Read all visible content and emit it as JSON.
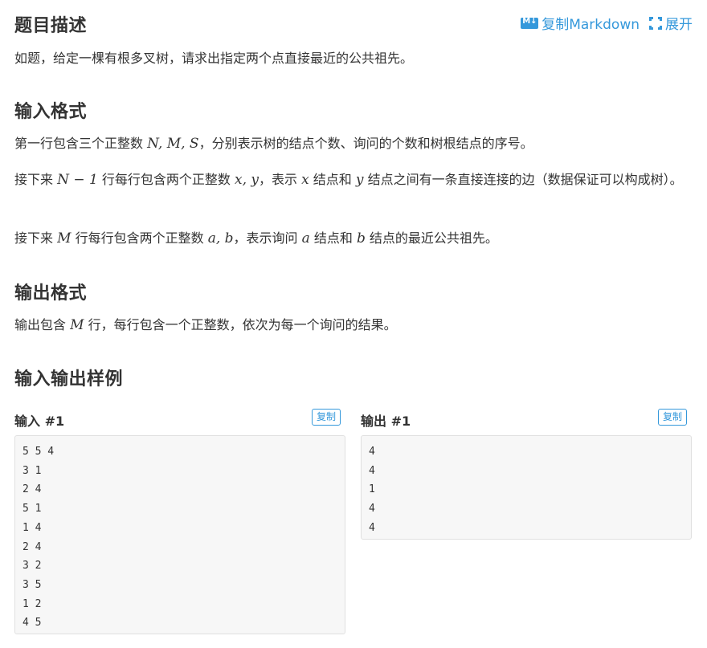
{
  "header": {
    "title": "题目描述",
    "copy_markdown": "复制Markdown",
    "expand": "展开"
  },
  "description": {
    "text": "如题，给定一棵有根多叉树，请求出指定两个点直接最近的公共祖先。"
  },
  "input_format": {
    "title": "输入格式",
    "p1": {
      "a": "第一行包含三个正整数 ",
      "math": "N, M, S",
      "b": "，分别表示树的结点个数、询问的个数和树根结点的序号。"
    },
    "p2": {
      "a": "接下来 ",
      "math1": "N − 1",
      "b": " 行每行包含两个正整数 ",
      "math2": "x, y",
      "c": "，表示 ",
      "math3": "x",
      "d": " 结点和 ",
      "math4": "y",
      "e": " 结点之间有一条直接连接的边（数据保证可以构成树）。"
    },
    "p3": {
      "a": "接下来 ",
      "math1": "M",
      "b": " 行每行包含两个正整数 ",
      "math2": "a, b",
      "c": "，表示询问 ",
      "math3": "a",
      "d": " 结点和 ",
      "math4": "b",
      "e": " 结点的最近公共祖先。"
    }
  },
  "output_format": {
    "title": "输出格式",
    "p1": {
      "a": "输出包含 ",
      "math": "M",
      "b": " 行，每行包含一个正整数，依次为每一个询问的结果。"
    }
  },
  "samples": {
    "title": "输入输出样例",
    "input": {
      "label": "输入 #1",
      "copy_label": "复制",
      "lines": [
        "5 5 4",
        "3 1",
        "2 4",
        "5 1",
        "1 4",
        "2 4",
        "3 2",
        "3 5",
        "1 2",
        "4 5"
      ]
    },
    "output": {
      "label": "输出 #1",
      "copy_label": "复制",
      "lines": [
        "4",
        "4",
        "1",
        "4",
        "4"
      ]
    }
  },
  "colors": {
    "accent": "#3498db",
    "text": "#333333",
    "code_bg": "#f7f7f7"
  }
}
